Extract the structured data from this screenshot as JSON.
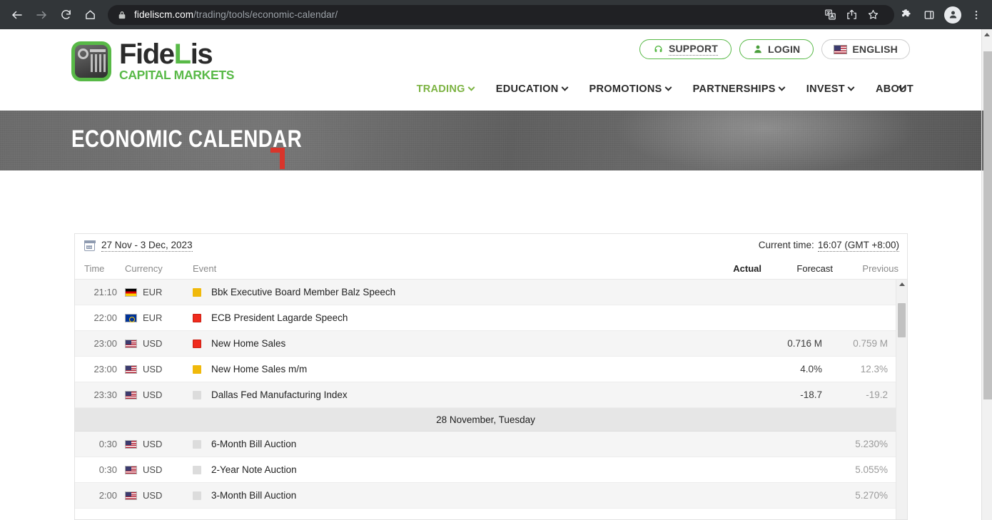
{
  "browser": {
    "url_host": "fideliscm.com",
    "url_path": "/trading/tools/economic-calendar/",
    "icons": {
      "back": "back-arrow-icon",
      "forward": "forward-arrow-icon",
      "reload": "reload-icon",
      "home": "home-icon",
      "lock": "lock-icon",
      "translate": "translate-icon",
      "share": "share-icon",
      "bookmark": "bookmark-star-icon",
      "extensions": "extensions-puzzle-icon",
      "sidepanel": "side-panel-icon",
      "profile": "profile-avatar-icon",
      "menu": "three-dot-menu-icon"
    }
  },
  "site": {
    "logo": {
      "name_main": "Fide",
      "name_accent": "L",
      "name_tail": "is",
      "subtitle": "CAPITAL MARKETS"
    },
    "top_buttons": [
      {
        "label": "SUPPORT",
        "icon": "headset-icon"
      },
      {
        "label": "LOGIN",
        "icon": "person-icon"
      },
      {
        "label": "ENGLISH",
        "icon": "us-flag-icon"
      }
    ],
    "nav": [
      {
        "label": "TRADING",
        "has_chevron": true,
        "active": true
      },
      {
        "label": "EDUCATION",
        "has_chevron": true,
        "active": false
      },
      {
        "label": "PROMOTIONS",
        "has_chevron": true,
        "active": false
      },
      {
        "label": "PARTNERSHIPS",
        "has_chevron": true,
        "active": false
      },
      {
        "label": "INVEST",
        "has_chevron": true,
        "active": false
      },
      {
        "label": "ABOUT",
        "has_chevron": true,
        "active": false
      }
    ],
    "hero_title": "ECONOMIC CALENDAR"
  },
  "calendar": {
    "date_range": "27 Nov - 3 Dec, 2023",
    "current_time_label": "Current time:",
    "current_time_value": "16:07 (GMT +8:00)",
    "columns": {
      "time": "Time",
      "currency": "Currency",
      "event": "Event",
      "actual": "Actual",
      "forecast": "Forecast",
      "previous": "Previous"
    },
    "rows": [
      {
        "kind": "event",
        "time": "21:10",
        "flag": "de",
        "currency": "EUR",
        "impact": "medium",
        "event": "Bbk Executive Board Member Balz Speech",
        "actual": "",
        "forecast": "",
        "previous": ""
      },
      {
        "kind": "event",
        "time": "22:00",
        "flag": "eu",
        "currency": "EUR",
        "impact": "high",
        "event": "ECB President Lagarde Speech",
        "actual": "",
        "forecast": "",
        "previous": ""
      },
      {
        "kind": "event",
        "time": "23:00",
        "flag": "us",
        "currency": "USD",
        "impact": "high",
        "event": "New Home Sales",
        "actual": "",
        "forecast": "0.716 M",
        "previous": "0.759 M"
      },
      {
        "kind": "event",
        "time": "23:00",
        "flag": "us",
        "currency": "USD",
        "impact": "medium",
        "event": "New Home Sales m/m",
        "actual": "",
        "forecast": "4.0%",
        "previous": "12.3%"
      },
      {
        "kind": "event",
        "time": "23:30",
        "flag": "us",
        "currency": "USD",
        "impact": "low",
        "event": "Dallas Fed Manufacturing Index",
        "actual": "",
        "forecast": "-18.7",
        "previous": "-19.2"
      },
      {
        "kind": "day",
        "label": "28 November, Tuesday"
      },
      {
        "kind": "event",
        "time": "0:30",
        "flag": "us",
        "currency": "USD",
        "impact": "low",
        "event": "6-Month Bill Auction",
        "actual": "",
        "forecast": "",
        "previous": "5.230%"
      },
      {
        "kind": "event",
        "time": "0:30",
        "flag": "us",
        "currency": "USD",
        "impact": "low",
        "event": "2-Year Note Auction",
        "actual": "",
        "forecast": "",
        "previous": "5.055%"
      },
      {
        "kind": "event",
        "time": "2:00",
        "flag": "us",
        "currency": "USD",
        "impact": "low",
        "event": "3-Month Bill Auction",
        "actual": "",
        "forecast": "",
        "previous": "5.270%"
      }
    ]
  },
  "colors": {
    "brand_green": "#58b947",
    "nav_active": "#7cb342",
    "impact_high": "#f02b1d",
    "impact_medium": "#f0b90b",
    "impact_low": "#dcdcdc",
    "hero_accent_red": "#d9352b",
    "chrome_bg": "#323639"
  }
}
